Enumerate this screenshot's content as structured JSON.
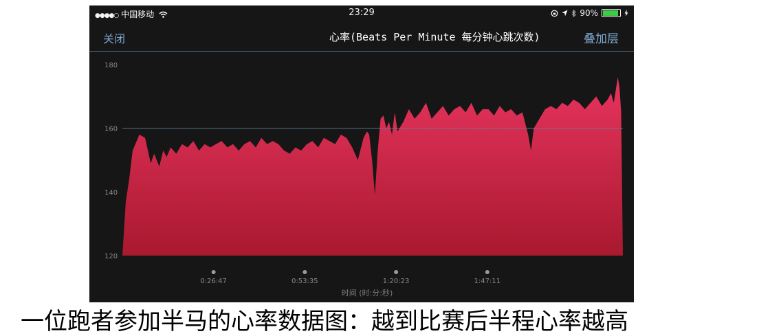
{
  "status_bar": {
    "signal": "●●●●○",
    "carrier": "中国移动",
    "time": "23:29",
    "battery": "90%",
    "battery_level": 0.9
  },
  "nav": {
    "close_label": "关闭",
    "title": "心率(Beats Per Minute 每分钟心跳次数)",
    "overlay_label": "叠加层"
  },
  "colors": {
    "background": "#161616",
    "accent": "#7da7cf",
    "area_top": "#e8345e",
    "area_bottom": "#a8192f",
    "reference_line": "#5e7d99"
  },
  "icons": [
    "signal-dots-icon",
    "wifi-icon",
    "lock-rotation-icon",
    "location-arrow-icon",
    "bluetooth-icon",
    "battery-icon",
    "charging-icon"
  ],
  "chart_data": {
    "type": "area",
    "title": "心率(Beats Per Minute 每分钟心跳次数)",
    "xlabel": "时间 (时:分:秒)",
    "ylabel": "",
    "ylim": [
      120,
      180
    ],
    "xlim": [
      0,
      8820
    ],
    "yticks": [
      120,
      140,
      160,
      180
    ],
    "xticks": [
      {
        "value": 1607,
        "label": "0:26:47"
      },
      {
        "value": 3215,
        "label": "0:53:35"
      },
      {
        "value": 4823,
        "label": "1:20:23"
      },
      {
        "value": 6431,
        "label": "1:47:11"
      }
    ],
    "reference_line": 160,
    "grid": false,
    "legend": "none",
    "series": [
      {
        "x": [
          0,
          60,
          120,
          180,
          300,
          400,
          500,
          560,
          650,
          720,
          780,
          850,
          950,
          1050,
          1150,
          1250,
          1350,
          1450,
          1550,
          1650,
          1750,
          1850,
          1950,
          2050,
          2150,
          2250,
          2350,
          2450,
          2550,
          2650,
          2750,
          2850,
          2950,
          3050,
          3150,
          3250,
          3350,
          3450,
          3550,
          3650,
          3750,
          3850,
          3950,
          4050,
          4150,
          4250,
          4310,
          4350,
          4400,
          4450,
          4500,
          4550,
          4600,
          4650,
          4700,
          4750,
          4800,
          4850,
          4950,
          5050,
          5150,
          5250,
          5350,
          5450,
          5550,
          5650,
          5750,
          5850,
          5950,
          6050,
          6150,
          6250,
          6350,
          6450,
          6550,
          6650,
          6750,
          6850,
          6950,
          7050,
          7150,
          7200,
          7250,
          7350,
          7450,
          7550,
          7650,
          7750,
          7850,
          7950,
          8050,
          8150,
          8250,
          8350,
          8450,
          8550,
          8610,
          8660,
          8730,
          8760,
          8790,
          8820
        ],
        "values": [
          120,
          137,
          144,
          153,
          158,
          157,
          149,
          152,
          148,
          153,
          151,
          154,
          152,
          155,
          154,
          156,
          153,
          155,
          154,
          155,
          156,
          154,
          155,
          153,
          155,
          156,
          154,
          157,
          155,
          156,
          155,
          153,
          152,
          154,
          153,
          155,
          156,
          154,
          157,
          156,
          155,
          158,
          157,
          154,
          150,
          157,
          159,
          158,
          150,
          139,
          153,
          163,
          164,
          160,
          162,
          158,
          165,
          159,
          162,
          166,
          163,
          165,
          168,
          163,
          165,
          167,
          164,
          166,
          167,
          165,
          168,
          164,
          166,
          166,
          164,
          167,
          165,
          166,
          164,
          165,
          158,
          153,
          160,
          163,
          166,
          167,
          166,
          168,
          167,
          169,
          168,
          166,
          168,
          170,
          167,
          169,
          171,
          168,
          176,
          173,
          165,
          120
        ]
      }
    ]
  },
  "caption": "一位跑者参加半马的心率数据图：越到比赛后半程心率越高"
}
